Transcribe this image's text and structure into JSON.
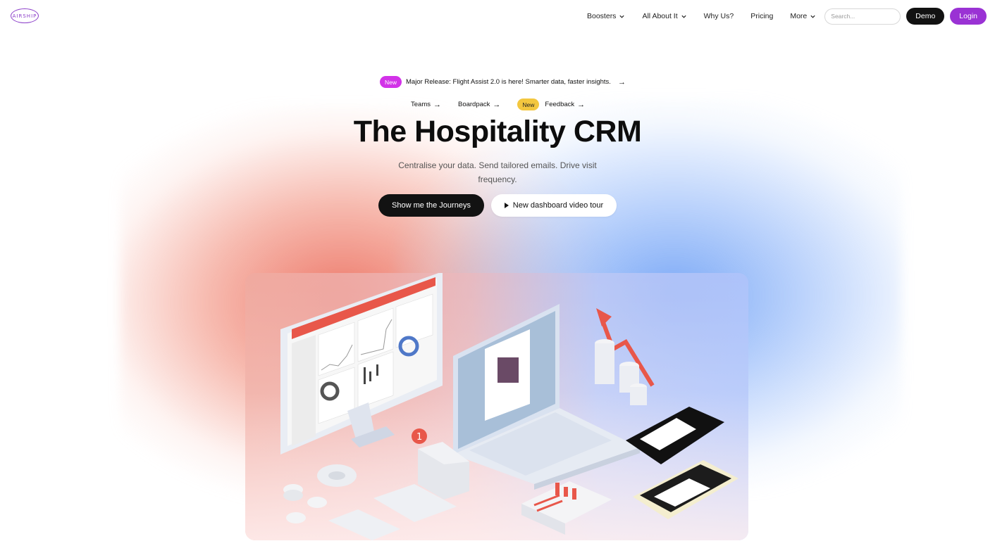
{
  "brand": {
    "logo_text": "AIRSHIP"
  },
  "nav": {
    "items": [
      {
        "label": "Boosters",
        "has_dropdown": true
      },
      {
        "label": "All About It",
        "has_dropdown": true
      },
      {
        "label": "Why Us?",
        "has_dropdown": false
      },
      {
        "label": "Pricing",
        "has_dropdown": false
      },
      {
        "label": "More",
        "has_dropdown": true
      }
    ],
    "search_placeholder": "Search...",
    "demo_label": "Demo",
    "login_label": "Login"
  },
  "announcement": {
    "badge": "New",
    "text": "Major Release: Flight Assist 2.0 is here! Smarter data, faster insights."
  },
  "sublinks": [
    {
      "label": "Teams",
      "badge": ""
    },
    {
      "label": "Boardpack",
      "badge": ""
    },
    {
      "label": "Feedback",
      "badge": "New"
    }
  ],
  "hero": {
    "title": "The Hospitality CRM",
    "subtitle": "Centralise your data. Send tailored emails. Drive visit frequency.",
    "cta_primary": "Show me the Journeys",
    "cta_secondary": "New dashboard video tour"
  },
  "illustration": {
    "notification_count": "1",
    "colors": {
      "accent_red": "#e8574a",
      "accent_purple": "#9a32d4",
      "badge_pink": "#d232e8",
      "badge_yellow": "#f3c73f"
    }
  }
}
